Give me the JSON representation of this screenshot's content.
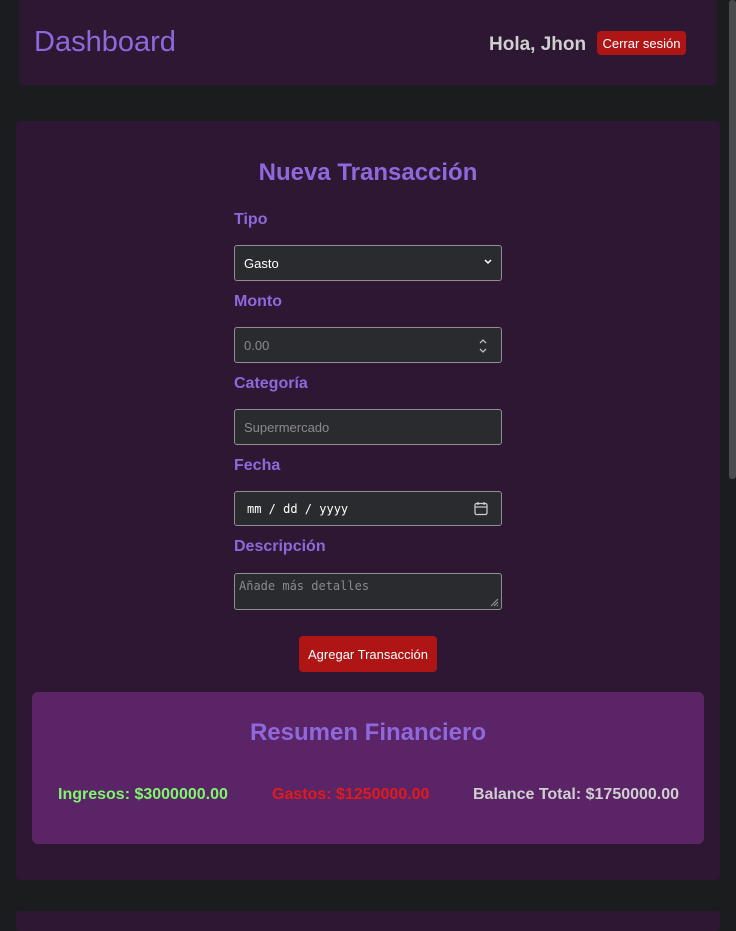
{
  "header": {
    "title": "Dashboard",
    "greeting": "Hola, Jhon",
    "logout_label": "Cerrar sesión"
  },
  "form": {
    "title": "Nueva Transacción",
    "type_label": "Tipo",
    "type_value": "Gasto",
    "amount_label": "Monto",
    "amount_placeholder": "0.00",
    "category_label": "Categoría",
    "category_placeholder": "Supermercado",
    "date_label": "Fecha",
    "date_placeholder": "mm / dd / yyyy",
    "description_label": "Descripción",
    "description_placeholder": "Añade más detalles",
    "submit_label": "Agregar Transacción"
  },
  "summary": {
    "title": "Resumen Financiero",
    "income": "Ingresos: $3000000.00",
    "expenses": "Gastos: $1250000.00",
    "balance": "Balance Total: $1750000.00"
  },
  "colors": {
    "accent": "#8f68dc",
    "danger": "#ae1616",
    "income": "#7cf86a",
    "expense": "#e01b1b",
    "balance": "#cfcfcf",
    "panel": "#2e1733",
    "summary_bg": "#5a2466"
  }
}
